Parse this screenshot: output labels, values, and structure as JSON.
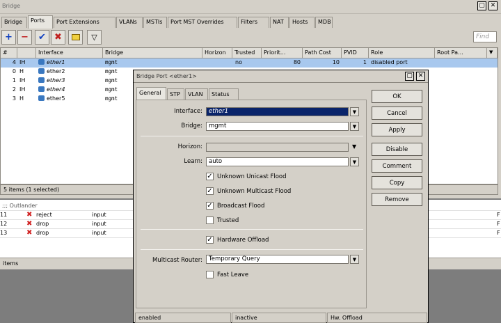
{
  "bridge_window": {
    "title": "Bridge",
    "tabs": [
      "Bridge",
      "Ports",
      "Port Extensions",
      "VLANs",
      "MSTIs",
      "Port MST Overrides",
      "Filters",
      "NAT",
      "Hosts",
      "MDB"
    ],
    "active_tab": "Ports",
    "find_placeholder": "Find",
    "columns": [
      "#",
      "",
      "Interface",
      "Bridge",
      "Horizon",
      "Trusted",
      "Priorit...",
      "Path Cost",
      "PVID",
      "Role",
      "Root Pa..."
    ],
    "rows": [
      {
        "num": "4",
        "flags": "IH",
        "interface": "ether1",
        "bridge": "mgmt",
        "horizon": "",
        "trusted": "no",
        "priority": "80",
        "path_cost": "10",
        "pvid": "1",
        "role": "disabled port",
        "root": ""
      },
      {
        "num": "0",
        "flags": "H",
        "interface": "ether2",
        "bridge": "mgmt"
      },
      {
        "num": "1",
        "flags": "IH",
        "interface": "ether3",
        "bridge": "mgmt"
      },
      {
        "num": "2",
        "flags": "IH",
        "interface": "ether4",
        "bridge": "mgmt"
      },
      {
        "num": "3",
        "flags": "H",
        "interface": "ether5",
        "bridge": "mgmt"
      }
    ],
    "status": "5 items (1 selected)"
  },
  "filter_window": {
    "comment": ";;; Outlander",
    "rows": [
      {
        "num": "11",
        "action": "reject",
        "chain": "input",
        "tail": "F"
      },
      {
        "num": "12",
        "action": "drop",
        "chain": "input",
        "tail": "F"
      },
      {
        "num": "13",
        "action": "drop",
        "chain": "input",
        "tail": "F"
      }
    ],
    "status": "items"
  },
  "dialog": {
    "title": "Bridge Port <ether1>",
    "tabs": [
      "General",
      "STP",
      "VLAN",
      "Status"
    ],
    "active_tab": "General",
    "interface_label": "Interface:",
    "interface_value": "ether1",
    "bridge_label": "Bridge:",
    "bridge_value": "mgmt",
    "horizon_label": "Horizon:",
    "horizon_value": "",
    "learn_label": "Learn:",
    "learn_value": "auto",
    "checkboxes": [
      {
        "label": "Unknown Unicast Flood",
        "checked": true
      },
      {
        "label": "Unknown Multicast Flood",
        "checked": true
      },
      {
        "label": "Broadcast Flood",
        "checked": true
      },
      {
        "label": "Trusted",
        "checked": false
      }
    ],
    "hw_offload": {
      "label": "Hardware Offload",
      "checked": true
    },
    "multicast_router_label": "Multicast Router:",
    "multicast_router_value": "Temporary Query",
    "fast_leave": {
      "label": "Fast Leave",
      "checked": false
    },
    "buttons": [
      "OK",
      "Cancel",
      "Apply",
      "Disable",
      "Comment",
      "Copy",
      "Remove"
    ],
    "status_bar": [
      "enabled",
      "inactive",
      "Hw. Offload"
    ]
  },
  "colors": {
    "selection": "#a8c8ee",
    "highlight": "#0a246a",
    "window": "#d4d0c8"
  }
}
